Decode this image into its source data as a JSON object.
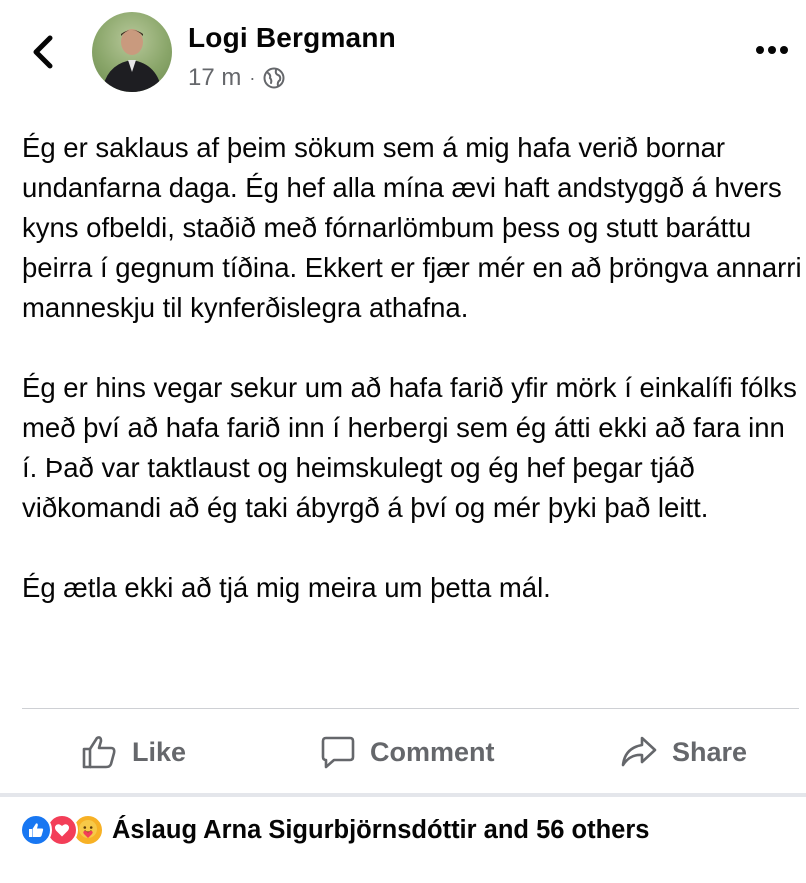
{
  "header": {
    "author_name": "Logi Bergmann",
    "timestamp": "17 m",
    "separator": "·",
    "privacy_icon": "globe-icon"
  },
  "post": {
    "paragraphs": [
      "Ég er saklaus af þeim sökum sem á mig hafa verið bornar undanfarna daga. Ég hef alla mína ævi haft andstyggð á hvers kyns ofbeldi, staðið með fórnarlömbum þess og stutt baráttu þeirra í gegnum tíðina. Ekkert er fjær mér en að þröngva annarri manneskju til kynferðislegra athafna.",
      "Ég er hins vegar sekur um að hafa farið yfir mörk í einkalífi fólks með því að hafa farið inn í herbergi sem ég átti ekki að fara inn í. Það var taktlaust og heimskulegt og ég hef þegar tjáð viðkomandi að ég taki ábyrgð á því og mér þyki það leitt.",
      "Ég ætla ekki að tjá mig meira um þetta mál."
    ]
  },
  "actions": {
    "like_label": "Like",
    "comment_label": "Comment",
    "share_label": "Share"
  },
  "reactions": {
    "icons": [
      "like-reaction-icon",
      "love-reaction-icon",
      "care-reaction-icon"
    ],
    "summary": "Áslaug Arna Sigurbjörnsdóttir and 56 others"
  },
  "colors": {
    "text": "#050505",
    "secondary_text": "#65676b",
    "like_blue": "#1877f2",
    "love_red": "#f33e58",
    "care_yellow": "#f7b125",
    "divider": "#ced0d4"
  }
}
